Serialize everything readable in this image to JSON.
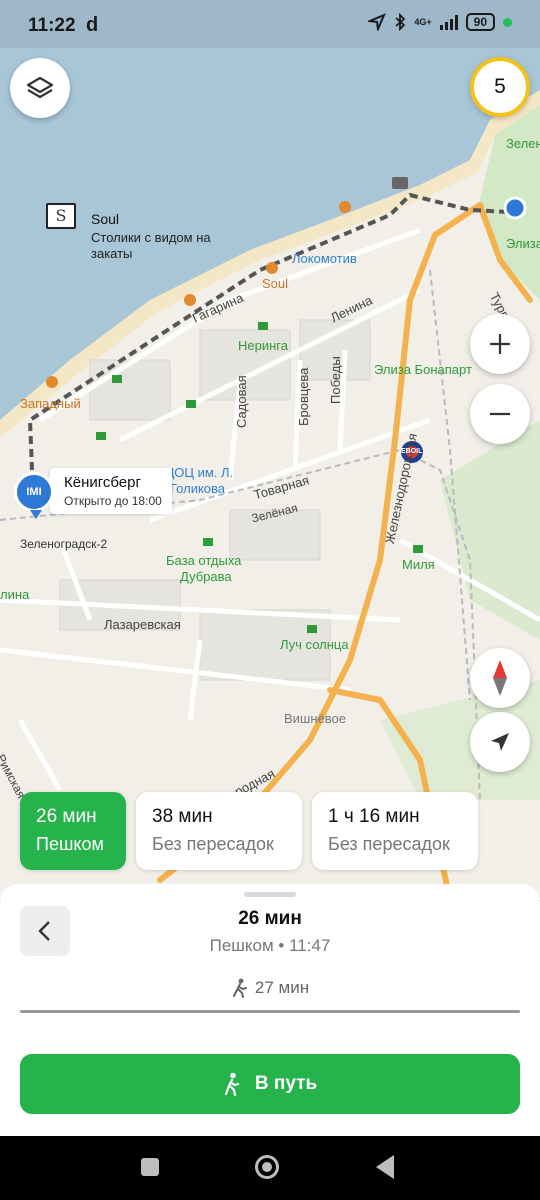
{
  "status_bar": {
    "time": "11:22",
    "carrier_glyph": "d",
    "network": "4G+",
    "battery": "90",
    "icons": [
      "location-arrow-icon",
      "bluetooth-icon",
      "signal-icon",
      "battery-icon"
    ]
  },
  "map": {
    "poi_layers_icon": "layers-icon",
    "bookmark_count": "5",
    "labels": {
      "soul_title": "Soul",
      "soul_desc_1": "Столики с видом на",
      "soul_desc_2": "закаты",
      "soul_small": "Soul",
      "lokomotiv": "Локомотив",
      "zeleno": "Зелен",
      "eliza_top": "Элиза",
      "turgeneva": "Тургенева",
      "gagarina": "Гагарина",
      "lenina": "Ленина",
      "neringa": "Неринга",
      "eliza_bonapart": "Элиза Бонапарт",
      "zapadny": "Западный",
      "sadovaya": "Садовая",
      "brovtseva": "Бровцева",
      "pobedy": "Победы",
      "zheleznodorozhnaya": "Железнодорожная",
      "dotsots": "ДОЦОЦ им. Л.",
      "golikova": "Голикова",
      "tovarnaya": "Товарная",
      "zelenaya": "Зелёная",
      "zelenogradsk2": "Зеленоградск-2",
      "baza_1": "База отдыха",
      "baza_2": "Дубрава",
      "milya": "Миля",
      "alina": "лина",
      "lazarevskaya": "Лазаревская",
      "luch": "Луч солнца",
      "vishnevoe": "Вишнёвое",
      "rimskaya": "Римская",
      "rodnaya": "родная",
      "eboil": "EBOIL"
    },
    "poi_card": {
      "title": "Кёнигсберг",
      "subtitle": "Открыто до 18:00",
      "pin_text": "IMI"
    },
    "controls": [
      "zoom-in-icon",
      "zoom-out-icon",
      "compass-icon",
      "my-location-icon"
    ],
    "colors": {
      "water": "#a9c6d6",
      "land": "#f1efe8",
      "road_major": "#f3b24e",
      "route": "#555555",
      "green_poi": "#2f9a3a",
      "accent_green": "#27b34c"
    }
  },
  "routes": [
    {
      "time": "26 мин",
      "mode": "Пешком",
      "active": true
    },
    {
      "time": "38 мин",
      "mode": "Без пересадок",
      "active": false
    },
    {
      "time": "1 ч 16 мин",
      "mode": "Без пересадок",
      "active": false
    }
  ],
  "sheet": {
    "title": "26 мин",
    "subtitle": "Пешком • 11:47",
    "walk_time": "27 мин",
    "go_label": "В путь",
    "icons": [
      "back-chevron-icon",
      "walk-icon"
    ]
  },
  "nav": {
    "icons": [
      "recent-apps-icon",
      "home-icon",
      "back-icon"
    ]
  }
}
